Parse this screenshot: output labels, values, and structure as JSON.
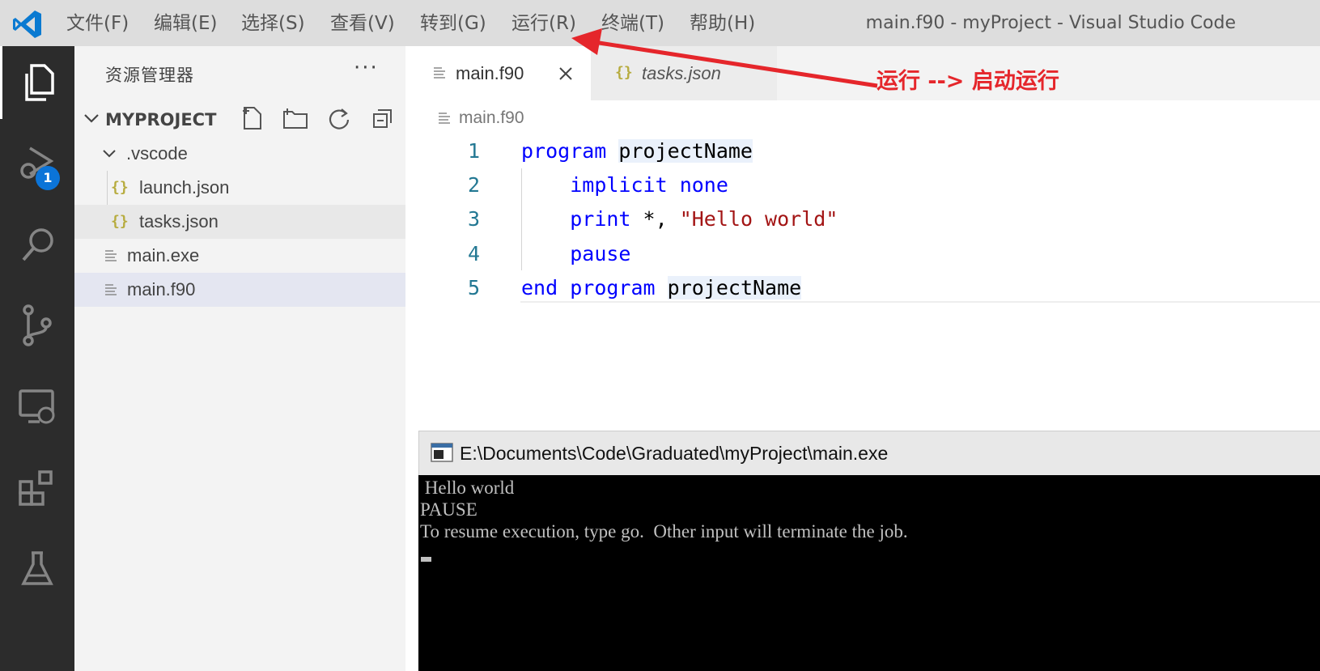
{
  "menu": {
    "items": [
      "文件(F)",
      "编辑(E)",
      "选择(S)",
      "查看(V)",
      "转到(G)",
      "运行(R)",
      "终端(T)",
      "帮助(H)"
    ],
    "window_title": "main.f90 - myProject - Visual Studio Code"
  },
  "activity_bar": {
    "icons": [
      "explorer-icon",
      "run-debug-icon",
      "search-icon",
      "source-control-icon",
      "remote-explorer-icon",
      "extensions-icon",
      "testing-icon"
    ],
    "debug_badge": "1"
  },
  "sidebar": {
    "title": "资源管理器",
    "more": "···",
    "project_name": "MYPROJECT",
    "tree": [
      {
        "label": ".vscode",
        "type": "folder"
      },
      {
        "label": "launch.json",
        "type": "json"
      },
      {
        "label": "tasks.json",
        "type": "json"
      },
      {
        "label": "main.exe",
        "type": "file"
      },
      {
        "label": "main.f90",
        "type": "file"
      }
    ]
  },
  "editor": {
    "tabs": [
      {
        "label": "main.f90",
        "active": true
      },
      {
        "label": "tasks.json",
        "active": false
      }
    ],
    "breadcrumb": "main.f90",
    "lines": [
      {
        "n": "1",
        "parts": [
          [
            "kw",
            "program"
          ],
          [
            "sp",
            " "
          ],
          [
            "id hl",
            "projectName"
          ]
        ]
      },
      {
        "n": "2",
        "parts": [
          [
            "sp",
            "    "
          ],
          [
            "kw",
            "implicit"
          ],
          [
            "sp",
            " "
          ],
          [
            "kw",
            "none"
          ]
        ]
      },
      {
        "n": "3",
        "parts": [
          [
            "sp",
            "    "
          ],
          [
            "kw",
            "print"
          ],
          [
            "id",
            " *, "
          ],
          [
            "str",
            "\"Hello world\""
          ]
        ]
      },
      {
        "n": "4",
        "parts": [
          [
            "sp",
            "    "
          ],
          [
            "kw",
            "pause"
          ]
        ]
      },
      {
        "n": "5",
        "parts": [
          [
            "kw",
            "end"
          ],
          [
            "sp",
            " "
          ],
          [
            "kw",
            "program"
          ],
          [
            "sp",
            " "
          ],
          [
            "id hl",
            "projectName"
          ]
        ]
      }
    ]
  },
  "console": {
    "title": "E:\\Documents\\Code\\Graduated\\myProject\\main.exe",
    "lines": [
      " Hello world",
      "PAUSE",
      "To resume execution, type go.  Other input will terminate the job."
    ]
  },
  "annotation": {
    "text": "运行 --> 启动运行",
    "color": "#e5262b"
  },
  "colors": {
    "keyword": "#0000ff",
    "string": "#a31515",
    "line_number": "#237893",
    "activity_bar": "#2c2c2c",
    "accent": "#0b74d8"
  }
}
